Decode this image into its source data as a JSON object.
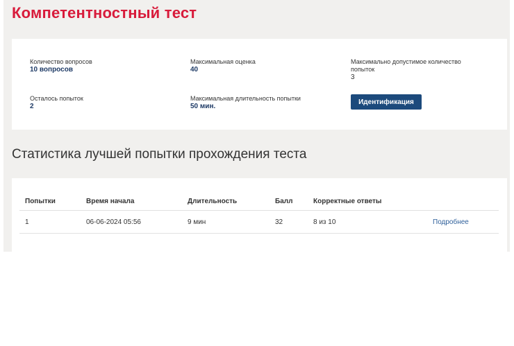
{
  "page": {
    "title": "Компетентностный тест"
  },
  "info": {
    "questions_count": {
      "label": "Количество вопросов",
      "value": "10 вопросов"
    },
    "max_score": {
      "label": "Максимальная оценка",
      "value": "40"
    },
    "max_attempts": {
      "label": "Максимально допустимое количество попыток",
      "value": "3"
    },
    "attempts_left": {
      "label": "Осталось попыток",
      "value": "2"
    },
    "max_duration": {
      "label": "Максимальная длительность попытки",
      "value": "50 мин."
    },
    "identify_button": "Идентификация"
  },
  "stats": {
    "title": "Статистика лучшей попытки прохождения теста",
    "headers": [
      "Попытки",
      "Время начала",
      "Длительность",
      "Балл",
      "Корректные ответы",
      ""
    ],
    "rows": [
      {
        "attempt": "1",
        "start": "06-06-2024 05:56",
        "duration": "9 мин",
        "score": "32",
        "correct": "8 из 10",
        "link": "Подробнее"
      }
    ]
  },
  "colors": {
    "title": "#d81b3b",
    "accent": "#1c4a7c",
    "link": "#2e5f9a",
    "background": "#f1f0ee"
  }
}
